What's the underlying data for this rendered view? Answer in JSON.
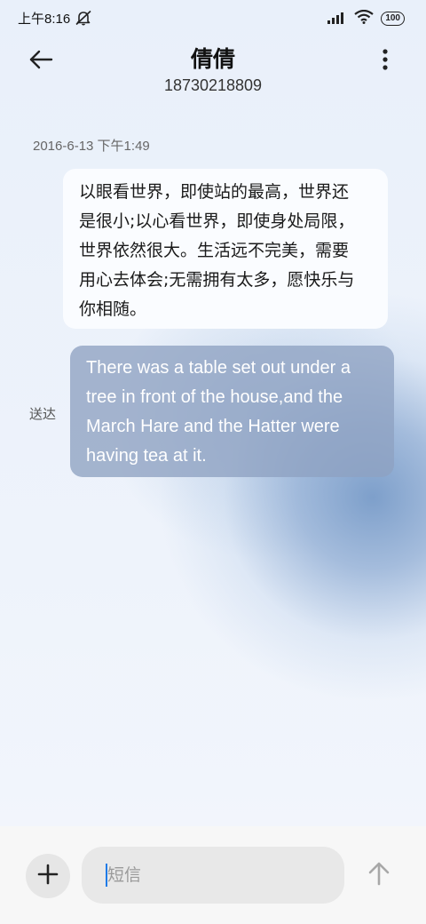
{
  "status_bar": {
    "time": "上午8:16",
    "battery": "100",
    "icons": [
      "bell-off-icon",
      "signal-icon",
      "wifi-icon",
      "battery-icon"
    ]
  },
  "header": {
    "contact_name": "倩倩",
    "phone_number": "18730218809",
    "icons": [
      "back-arrow-icon",
      "more-vertical-icon"
    ]
  },
  "conversation": {
    "timestamp": "2016-6-13 下午1:49",
    "messages": [
      {
        "direction": "incoming",
        "lines": [
          "以眼看世界，即使站的最高，世界还",
          "是很小;以心看世界，即使身处局限，",
          "世界依然很大。生活远不完美，需要",
          "用心去体会;无需拥有太多，愿快乐与",
          "你相随。"
        ]
      },
      {
        "direction": "outgoing",
        "status": "送达",
        "lines": [
          "There was a table set out under a",
          "tree in front of the house,and the",
          "March Hare and the Hatter were",
          "having tea at it."
        ]
      }
    ]
  },
  "composer": {
    "placeholder": "短信",
    "value": "",
    "icons": [
      "plus-icon",
      "send-arrow-up-icon"
    ]
  },
  "colors": {
    "outgoing_bubble": "#8EA2C2",
    "incoming_bubble": "#FAFCFF",
    "caret": "#1E7BE8"
  }
}
